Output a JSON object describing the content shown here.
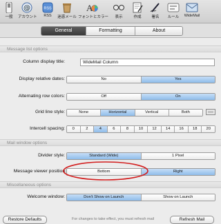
{
  "toolbar": {
    "items": [
      {
        "label": "一般",
        "icon": "switch-icon"
      },
      {
        "label": "アカウント",
        "icon": "at-sign-icon"
      },
      {
        "label": "RSS",
        "icon": "rss-icon"
      },
      {
        "label": "迷惑メール",
        "icon": "junk-mail-icon"
      },
      {
        "label": "フォントとカラー",
        "icon": "fonts-colors-icon"
      },
      {
        "label": "表示",
        "icon": "glasses-icon"
      },
      {
        "label": "作成",
        "icon": "compose-icon"
      },
      {
        "label": "署名",
        "icon": "signature-icon"
      },
      {
        "label": "ルール",
        "icon": "rules-icon"
      },
      {
        "label": "WideMail",
        "icon": "widemail-icon"
      }
    ]
  },
  "tabs": [
    "General",
    "Formatting",
    "About"
  ],
  "sections": {
    "message_list": "Message list options",
    "mail_window": "Mail window options",
    "misc": "Miscellaneous options"
  },
  "column_title": {
    "label": "Column display title:",
    "value": "WideMail Column"
  },
  "relative_dates": {
    "label": "Display relative dates:",
    "options": [
      "No",
      "Yes"
    ],
    "selected": 1
  },
  "alternating_colors": {
    "label": "Alternating row colors:",
    "options": [
      "Off",
      "On"
    ],
    "selected": 1
  },
  "grid_style": {
    "label": "Grid line style:",
    "options": [
      "None",
      "Horizontal",
      "Vertical",
      "Both"
    ],
    "selected": 1
  },
  "intercell_spacing": {
    "label": "Intercell spacing:",
    "options": [
      "0",
      "2",
      "4",
      "6",
      "8",
      "10",
      "12",
      "14",
      "16",
      "18",
      "20"
    ],
    "selected": 2
  },
  "divider_style": {
    "label": "Divider style:",
    "options": [
      "Standard (Wide)",
      "1 Pixel"
    ],
    "selected": 0
  },
  "viewer_position": {
    "label": "Message viewer position:",
    "options": [
      "Bottom",
      "Right"
    ],
    "selected": 1
  },
  "welcome_window": {
    "label": "Welcome window:",
    "options": [
      "Don't Show on Launch",
      "Show on Launch"
    ],
    "selected": 0
  },
  "bottom": {
    "restore_label": "Restore Defaults",
    "note": "For changes to take effect, you must refresh mail",
    "refresh_label": "Refresh Mail"
  },
  "colors": {
    "accent": "#8fbcea",
    "highlight_circle": "#d21c1c"
  }
}
